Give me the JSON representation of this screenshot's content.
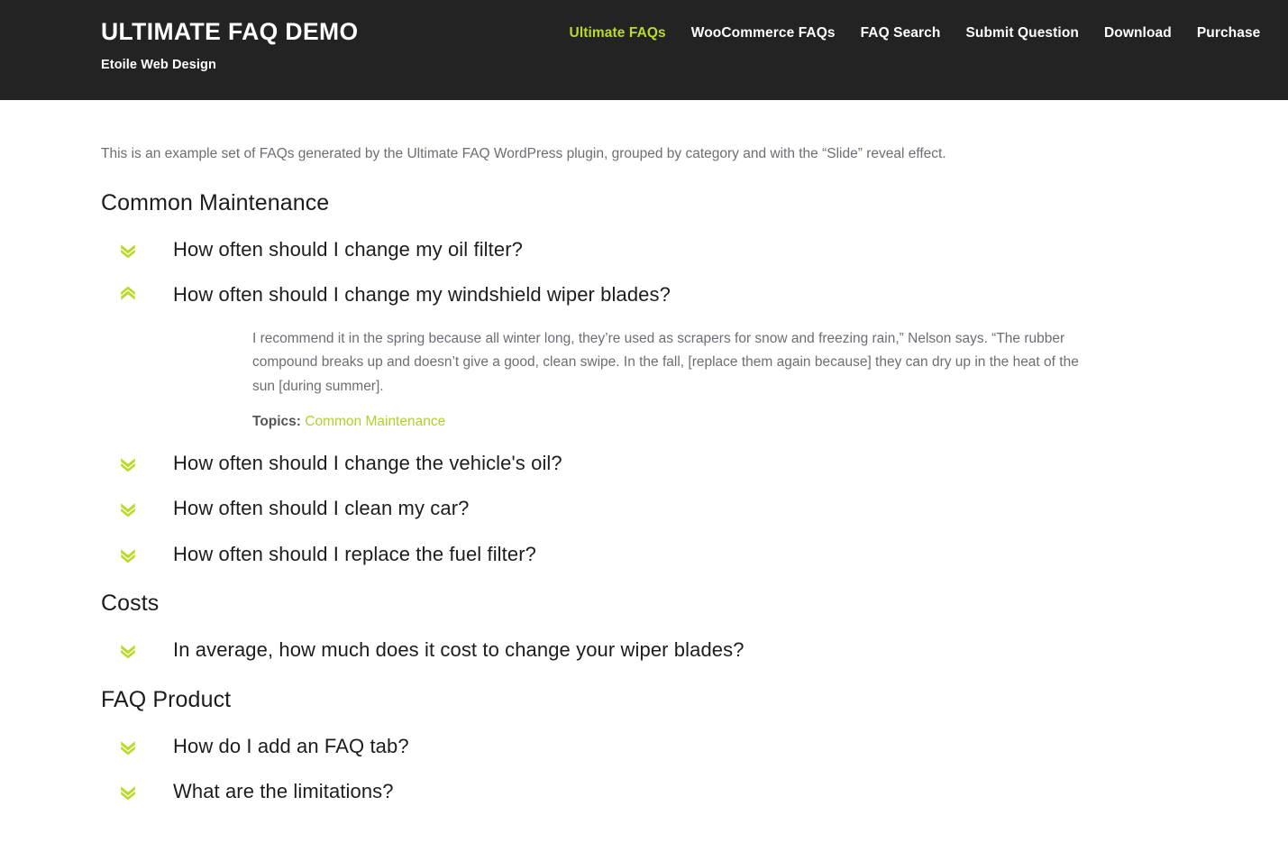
{
  "header": {
    "brand_title": "ULTIMATE FAQ DEMO",
    "brand_tagline": "Etoile Web Design",
    "nav": [
      {
        "label": "Ultimate FAQs",
        "active": true
      },
      {
        "label": "WooCommerce FAQs",
        "active": false
      },
      {
        "label": "FAQ Search",
        "active": false
      },
      {
        "label": "Submit Question",
        "active": false
      },
      {
        "label": "Download",
        "active": false
      },
      {
        "label": "Purchase",
        "active": false
      }
    ]
  },
  "main": {
    "intro": "This is an example set of FAQs generated by the Ultimate FAQ WordPress plugin, grouped by category and with the “Slide” reveal effect.",
    "categories": [
      {
        "title": "Common Maintenance",
        "items": [
          {
            "question": "How often should I change my oil filter?",
            "expanded": false,
            "icon": "chevron-double-down-icon"
          },
          {
            "question": "How often should I change my windshield wiper blades?",
            "expanded": true,
            "icon": "chevron-double-up-icon",
            "answer": "I recommend it in the spring because all winter long, they’re used as scrapers for snow and freezing rain,” Nelson says. “The rubber compound breaks up and doesn’t give a good, clean swipe. In the fall, [replace them again because] they can dry up in the heat of the sun [during summer].",
            "topics_label": "Topics:",
            "topics_link": "Common Maintenance"
          },
          {
            "question": "How often should I change the vehicle's oil?",
            "expanded": false,
            "icon": "chevron-double-down-icon"
          },
          {
            "question": "How often should I clean my car?",
            "expanded": false,
            "icon": "chevron-double-down-icon"
          },
          {
            "question": "How often should I replace the fuel filter?",
            "expanded": false,
            "icon": "chevron-double-down-icon"
          }
        ]
      },
      {
        "title": "Costs",
        "items": [
          {
            "question": "In average, how much does it cost to change your wiper blades?",
            "expanded": false,
            "icon": "chevron-double-down-icon"
          }
        ]
      },
      {
        "title": "FAQ Product",
        "items": [
          {
            "question": "How do I add an FAQ tab?",
            "expanded": false,
            "icon": "chevron-double-down-icon"
          },
          {
            "question": "What are the limitations?",
            "expanded": false,
            "icon": "chevron-double-down-icon"
          }
        ]
      }
    ]
  },
  "colors": {
    "header_bg": "#232323",
    "accent_green": "#bada2a",
    "body_text": "#1d1d1d",
    "muted_text": "#6d6d76",
    "page_bg": "#ffffff"
  }
}
